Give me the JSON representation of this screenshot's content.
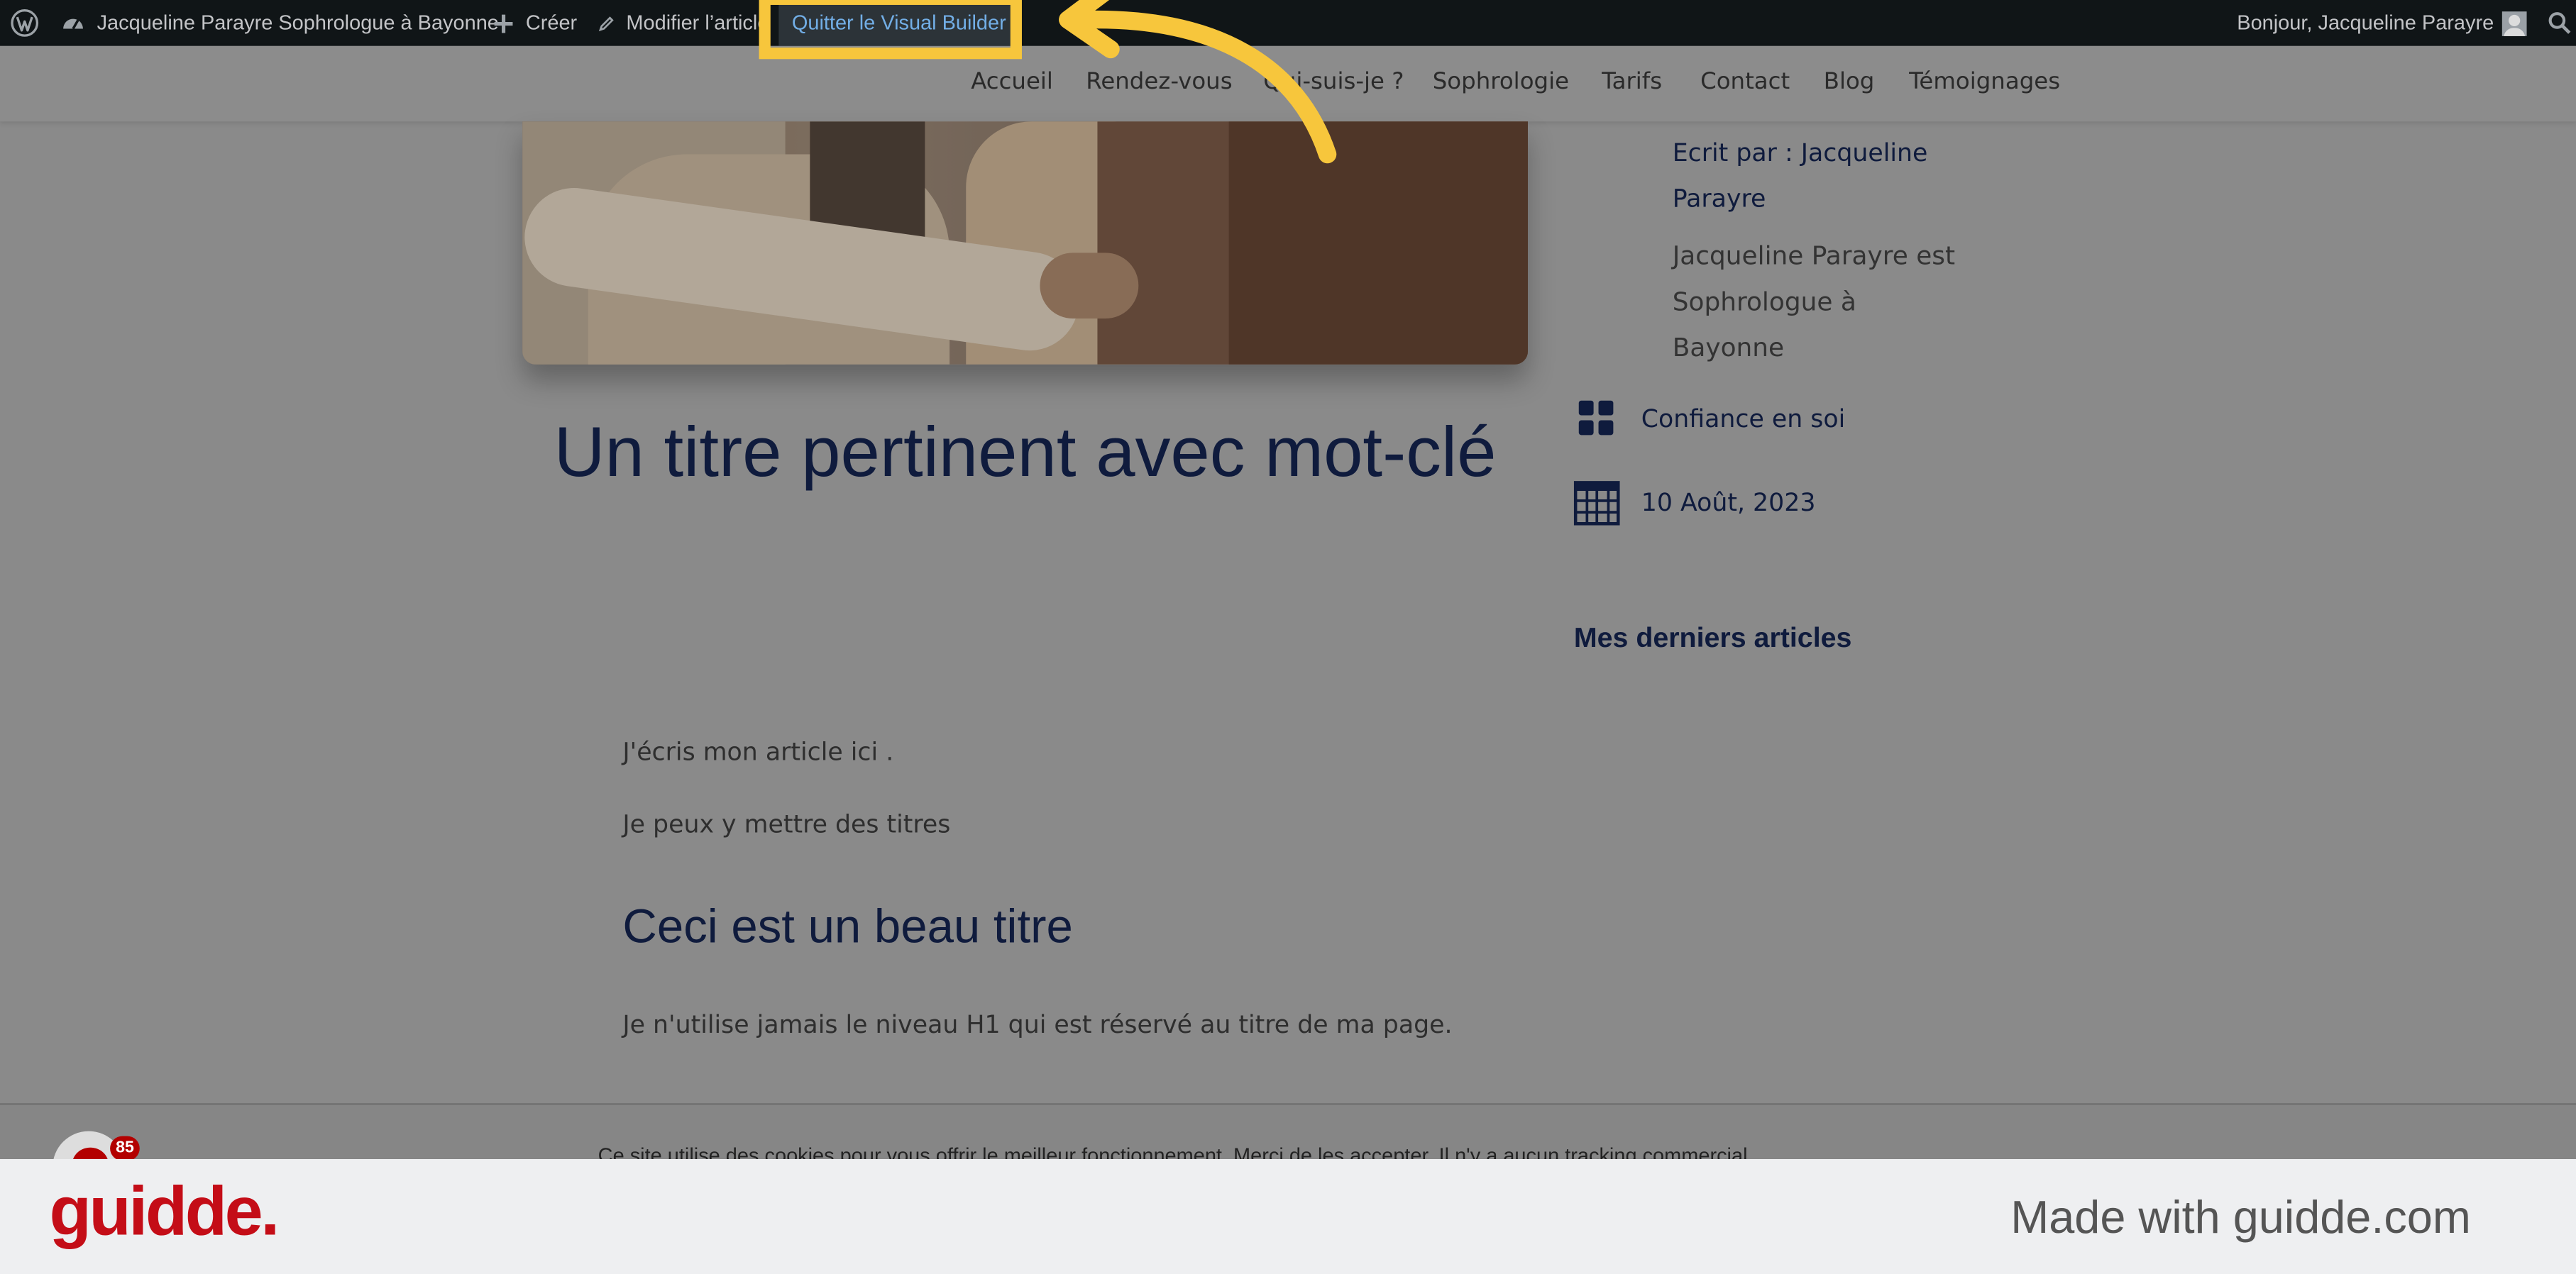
{
  "admin_bar": {
    "site_name": "Jacqueline Parayre Sophrologue à Bayonne",
    "create": "Créer",
    "edit_article": "Modifier l’article",
    "quit_visual_builder": "Quitter le Visual Builder",
    "greeting": "Bonjour, Jacqueline Parayre"
  },
  "nav": {
    "items": [
      "Accueil",
      "Rendez-vous",
      "Qui-suis-je ?",
      "Sophrologie",
      "Tarifs",
      "Contact",
      "Blog",
      "Témoignages"
    ]
  },
  "article": {
    "title": "Un titre pertinent avec mot-clé",
    "paragraph_1": "J'écris mon article ici .",
    "paragraph_2": "Je peux y mettre des titres",
    "heading_2": "Ceci est un beau titre",
    "paragraph_3": "Je n'utilise jamais le niveau H1 qui est réservé au titre de ma page."
  },
  "sidebar": {
    "author_line_1": "Ecrit par : Jacqueline",
    "author_line_2": "Parayre",
    "bio_line_1": "Jacqueline Parayre est",
    "bio_line_2": "Sophrologue à",
    "bio_line_3": "Bayonne",
    "category": "Confiance en soi",
    "date": "10 Août, 2023",
    "latest_heading": "Mes derniers articles"
  },
  "cookie_bar": {
    "text": "Ce site utilise des cookies pour vous offrir le meilleur fonctionnement. Merci de les accepter. Il n'y a aucun tracking commercial.",
    "badge_count": "85"
  },
  "footer": {
    "logo": "guidde.",
    "made_with": "Made with guidde.com"
  },
  "colors": {
    "admin_bar_bg": "#101517",
    "active_link": "#72aee6",
    "highlight": "#f7c63c",
    "title_navy": "#0f1b3d",
    "guidde_red": "#c40d17"
  },
  "icons": [
    "wordpress-icon",
    "dashboard-icon",
    "plus-icon",
    "pencil-icon",
    "search-icon",
    "grid-icon",
    "calendar-icon"
  ]
}
